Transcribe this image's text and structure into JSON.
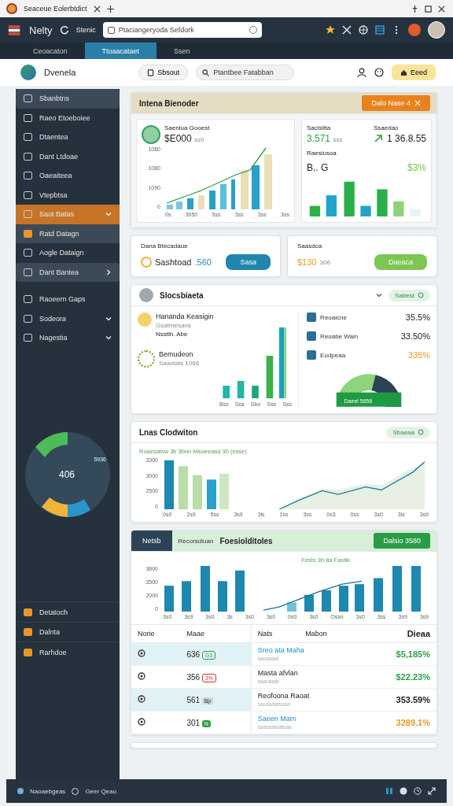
{
  "browser": {
    "tab_title": "Seaceue Eolerbtdict",
    "brand": "Nelty",
    "nav_label": "Stenic",
    "address": "Ptaciangeryoda Sefdork"
  },
  "app_tabs": [
    {
      "label": "Ceoacaton",
      "selected": false
    },
    {
      "label": "Ttoaacataet",
      "selected": true
    },
    {
      "label": "Ssen",
      "selected": false
    }
  ],
  "header": {
    "title": "Dvenela",
    "button": "Sbsout",
    "search_placeholder": "Ptantbee Fatabban",
    "action": "Eeed"
  },
  "sidebar": {
    "items": [
      {
        "label": "Sbanbtns",
        "highlighted": true,
        "selected": false
      },
      {
        "label": "Raeo Etoeboiee",
        "highlighted": false,
        "selected": false
      },
      {
        "label": "Dtaentea",
        "highlighted": false,
        "selected": false
      },
      {
        "label": "Dant Ltdoae",
        "highlighted": false,
        "selected": false
      },
      {
        "label": "Oaeaiteea",
        "highlighted": false,
        "selected": false
      },
      {
        "label": "Vtepbtsa",
        "highlighted": false,
        "selected": false
      },
      {
        "label": "Saot Batas",
        "highlighted": false,
        "selected": true,
        "expanded": true,
        "children": [
          {
            "label": "Ratd Datagn"
          }
        ]
      },
      {
        "label": "Aogle Dataign",
        "highlighted": false,
        "selected": false
      },
      {
        "label": "Dant Bantea",
        "highlighted": true,
        "selected": false,
        "expanded": false
      }
    ],
    "items_2": [
      {
        "label": "Raoeern Gaps"
      },
      {
        "label": "Sodeora",
        "expanded": false
      },
      {
        "label": "Nagestia",
        "expanded": false
      }
    ],
    "donut_value": "5936",
    "donut_center": "406",
    "bottom_items": [
      "Detatoch",
      "Dalnta",
      "Rarhdoe"
    ]
  },
  "overview": {
    "title": "Intena Bienoder",
    "button": "Dalo Nase",
    "badge": "4",
    "sales": {
      "label": "Saenlua Gooest",
      "value": "$E000",
      "note": "ss9",
      "y_labels": [
        "1080",
        "1080",
        "1090",
        "0"
      ],
      "x_labels": [
        "0s",
        "3050",
        "5ss",
        "3ss",
        "3ss",
        "3ss"
      ]
    },
    "stats": {
      "label_1": "Sacisitta",
      "value_1": "3.571",
      "note_1": "sss",
      "label_2": "Ssaedao",
      "value_2": "1 36.8.55",
      "label_3": "Raesiusoa",
      "value_3": "B.. G",
      "percent": "$3%"
    }
  },
  "mini_cards": [
    {
      "label": "Dana Btecadaue",
      "value": "Sashtoad",
      "note": ".560",
      "button": "Sasa",
      "kind": "blue"
    },
    {
      "label": "Saasdca",
      "value": "$130",
      "note": "306",
      "button": "Daeaca",
      "kind": "green"
    }
  ],
  "stock": {
    "title": "Slocsbiaeta",
    "badge": "Sabest",
    "entries": [
      {
        "title": "Hananda Keasigin",
        "subtitle": "Gsatmesans",
        "detail": "Nsstlh. Abe"
      },
      {
        "title": "Bemudeon",
        "subtitle": "Saaotals 1066"
      }
    ],
    "x_labels": [
      "Bss",
      "Ssa",
      "Sbo",
      "Sse",
      "Sss"
    ],
    "metrics": [
      {
        "label": "Reoaicne",
        "value": "35.5%",
        "color": "#222222"
      },
      {
        "label": "Reoabe Wain",
        "value": "33.50%",
        "color": "#222222"
      },
      {
        "label": "Eudpeaa",
        "value": "335%",
        "color": "#e89a2a"
      }
    ],
    "gauge_label": "Daeel 5656"
  },
  "trend": {
    "title": "Lnas Clodwiton",
    "badge": "Sbaeaa",
    "legend": "Roaesatsw 3b 3bnn Msoeeaad 30 (esse)",
    "y_labels": [
      "3300",
      "3000",
      "2500",
      "0"
    ],
    "x_labels": [
      "0s0",
      "2s9",
      "5ss",
      "3s9",
      "3is",
      "1ss",
      "3ss",
      "0s3",
      "0ss",
      "3s0",
      "3ls",
      "3s9"
    ]
  },
  "report": {
    "tab": "Netsb",
    "subtitle": "Recorsdiuan",
    "title": "Foesiolditoles",
    "button": "Dalsio 3580",
    "legend": "Fests 3h 8a Faotki",
    "y_labels": [
      "3600",
      "3500",
      "2000",
      "0"
    ],
    "x_labels": [
      "3s0",
      "3s9",
      "3s0",
      "3s",
      "3s0",
      "3s0",
      "0s0",
      "3s0",
      "Ossn",
      "3s0",
      "3ss",
      "3s9",
      "3s9"
    ],
    "columns": [
      "Norie",
      "Maae",
      "Nats",
      "Mabon",
      "Dieaa"
    ],
    "rows": [
      {
        "number": "636",
        "badge": {
          "text": "G3",
          "kind": "outline",
          "color": "#2e9e4a"
        },
        "name": "Sreo ata Maha",
        "sub": "saoaaaat",
        "value": "$5,185%",
        "color": "#2e9e4a",
        "selected": true,
        "link": true
      },
      {
        "number": "356",
        "badge": {
          "text": "3%",
          "kind": "outline",
          "color": "#cc3333"
        },
        "name": "Masta afvlan",
        "sub": "saaoaaat",
        "value": "$22.23%",
        "color": "#2e9e4a",
        "selected": false,
        "link": false
      },
      {
        "number": "561",
        "badge": {
          "text": "Bp",
          "kind": "filled",
          "color": "#cfd5d9"
        },
        "name": "Reofoona Raoat",
        "sub": "saoaa/tatsoaa",
        "value": "353.59%",
        "color": "#222222",
        "selected": true,
        "link": false
      },
      {
        "number": "301",
        "badge": {
          "text": "N",
          "kind": "filled",
          "color": "#2e9e4a"
        },
        "name": "Saeen Mam",
        "sub": "saaoaatnatoaa",
        "value": "3289.1%",
        "color": "#e89a2a",
        "selected": false,
        "link": true
      }
    ]
  },
  "status_bar": {
    "left": "Naoaebgeas",
    "right": "Geer Qeau"
  }
}
